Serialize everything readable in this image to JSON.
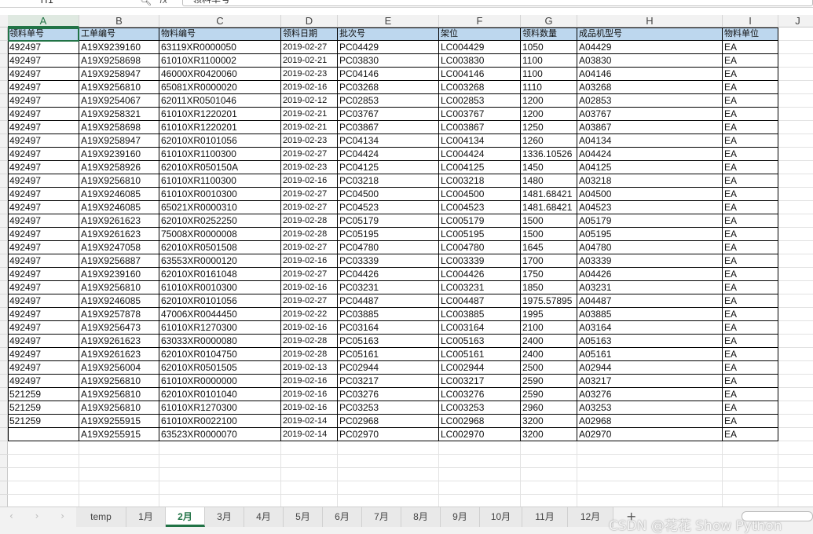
{
  "formula_bar": {
    "name_box": "H1",
    "fx": "fx",
    "value": "领料单号"
  },
  "columns": [
    "A",
    "B",
    "C",
    "D",
    "E",
    "F",
    "G",
    "H",
    "I",
    "J"
  ],
  "headers": [
    "领料单号",
    "工单编号",
    "物料编号",
    "领料日期",
    "批次号",
    "架位",
    "领料数量",
    "成品机型号",
    "物料单位"
  ],
  "rows": [
    [
      "492497",
      "A19X9239160",
      "63119XR0000050",
      "2019-02-27",
      "PC04429",
      "LC004429",
      "1050",
      "A04429",
      "EA"
    ],
    [
      "492497",
      "A19X9258698",
      "61010XR1100002",
      "2019-02-21",
      "PC03830",
      "LC003830",
      "1100",
      "A03830",
      "EA"
    ],
    [
      "492497",
      "A19X9258947",
      "46000XR0420060",
      "2019-02-23",
      "PC04146",
      "LC004146",
      "1100",
      "A04146",
      "EA"
    ],
    [
      "492497",
      "A19X9256810",
      "65081XR0000020",
      "2019-02-16",
      "PC03268",
      "LC003268",
      "1110",
      "A03268",
      "EA"
    ],
    [
      "492497",
      "A19X9254067",
      "62011XR0501046",
      "2019-02-12",
      "PC02853",
      "LC002853",
      "1200",
      "A02853",
      "EA"
    ],
    [
      "492497",
      "A19X9258321",
      "61010XR1220201",
      "2019-02-21",
      "PC03767",
      "LC003767",
      "1200",
      "A03767",
      "EA"
    ],
    [
      "492497",
      "A19X9258698",
      "61010XR1220201",
      "2019-02-21",
      "PC03867",
      "LC003867",
      "1250",
      "A03867",
      "EA"
    ],
    [
      "492497",
      "A19X9258947",
      "62010XR0101056",
      "2019-02-23",
      "PC04134",
      "LC004134",
      "1260",
      "A04134",
      "EA"
    ],
    [
      "492497",
      "A19X9239160",
      "61010XR1100300",
      "2019-02-27",
      "PC04424",
      "LC004424",
      "1336.10526",
      "A04424",
      "EA"
    ],
    [
      "492497",
      "A19X9258926",
      "62010XR050150A",
      "2019-02-23",
      "PC04125",
      "LC004125",
      "1450",
      "A04125",
      "EA"
    ],
    [
      "492497",
      "A19X9256810",
      "61010XR1100300",
      "2019-02-16",
      "PC03218",
      "LC003218",
      "1480",
      "A03218",
      "EA"
    ],
    [
      "492497",
      "A19X9246085",
      "61010XR0010300",
      "2019-02-27",
      "PC04500",
      "LC004500",
      "1481.68421",
      "A04500",
      "EA"
    ],
    [
      "492497",
      "A19X9246085",
      "65021XR0000310",
      "2019-02-27",
      "PC04523",
      "LC004523",
      "1481.68421",
      "A04523",
      "EA"
    ],
    [
      "492497",
      "A19X9261623",
      "62010XR0252250",
      "2019-02-28",
      "PC05179",
      "LC005179",
      "1500",
      "A05179",
      "EA"
    ],
    [
      "492497",
      "A19X9261623",
      "75008XR0000008",
      "2019-02-28",
      "PC05195",
      "LC005195",
      "1500",
      "A05195",
      "EA"
    ],
    [
      "492497",
      "A19X9247058",
      "62010XR0501508",
      "2019-02-27",
      "PC04780",
      "LC004780",
      "1645",
      "A04780",
      "EA"
    ],
    [
      "492497",
      "A19X9256887",
      "63553XR0000120",
      "2019-02-16",
      "PC03339",
      "LC003339",
      "1700",
      "A03339",
      "EA"
    ],
    [
      "492497",
      "A19X9239160",
      "62010XR0161048",
      "2019-02-27",
      "PC04426",
      "LC004426",
      "1750",
      "A04426",
      "EA"
    ],
    [
      "492497",
      "A19X9256810",
      "61010XR0010300",
      "2019-02-16",
      "PC03231",
      "LC003231",
      "1850",
      "A03231",
      "EA"
    ],
    [
      "492497",
      "A19X9246085",
      "62010XR0101056",
      "2019-02-27",
      "PC04487",
      "LC004487",
      "1975.57895",
      "A04487",
      "EA"
    ],
    [
      "492497",
      "A19X9257878",
      "47006XR0044450",
      "2019-02-22",
      "PC03885",
      "LC003885",
      "1995",
      "A03885",
      "EA"
    ],
    [
      "492497",
      "A19X9256473",
      "61010XR1270300",
      "2019-02-16",
      "PC03164",
      "LC003164",
      "2100",
      "A03164",
      "EA"
    ],
    [
      "492497",
      "A19X9261623",
      "63033XR0000080",
      "2019-02-28",
      "PC05163",
      "LC005163",
      "2400",
      "A05163",
      "EA"
    ],
    [
      "492497",
      "A19X9261623",
      "62010XR0104750",
      "2019-02-28",
      "PC05161",
      "LC005161",
      "2400",
      "A05161",
      "EA"
    ],
    [
      "492497",
      "A19X9256004",
      "62010XR0501505",
      "2019-02-13",
      "PC02944",
      "LC002944",
      "2500",
      "A02944",
      "EA"
    ],
    [
      "492497",
      "A19X9256810",
      "61010XR0000000",
      "2019-02-16",
      "PC03217",
      "LC003217",
      "2590",
      "A03217",
      "EA"
    ],
    [
      "521259",
      "A19X9256810",
      "62010XR0101040",
      "2019-02-16",
      "PC03276",
      "LC003276",
      "2590",
      "A03276",
      "EA"
    ],
    [
      "521259",
      "A19X9256810",
      "61010XR1270300",
      "2019-02-16",
      "PC03253",
      "LC003253",
      "2960",
      "A03253",
      "EA"
    ],
    [
      "521259",
      "A19X9255915",
      "61010XR0022100",
      "2019-02-14",
      "PC02968",
      "LC002968",
      "3200",
      "A02968",
      "EA"
    ],
    [
      "",
      "A19X9255915",
      "63523XR0000070",
      "2019-02-14",
      "PC02970",
      "LC002970",
      "3200",
      "A02970",
      "EA"
    ]
  ],
  "sheet_tabs": [
    "temp",
    "1月",
    "2月",
    "3月",
    "4月",
    "5月",
    "6月",
    "7月",
    "8月",
    "9月",
    "10月",
    "11月",
    "12月"
  ],
  "active_tab": "2月",
  "add_tab": "+",
  "watermark": "CSDN @花花 Show Python",
  "colors": {
    "header_fill": "#bdd7ee",
    "accent": "#217346"
  }
}
